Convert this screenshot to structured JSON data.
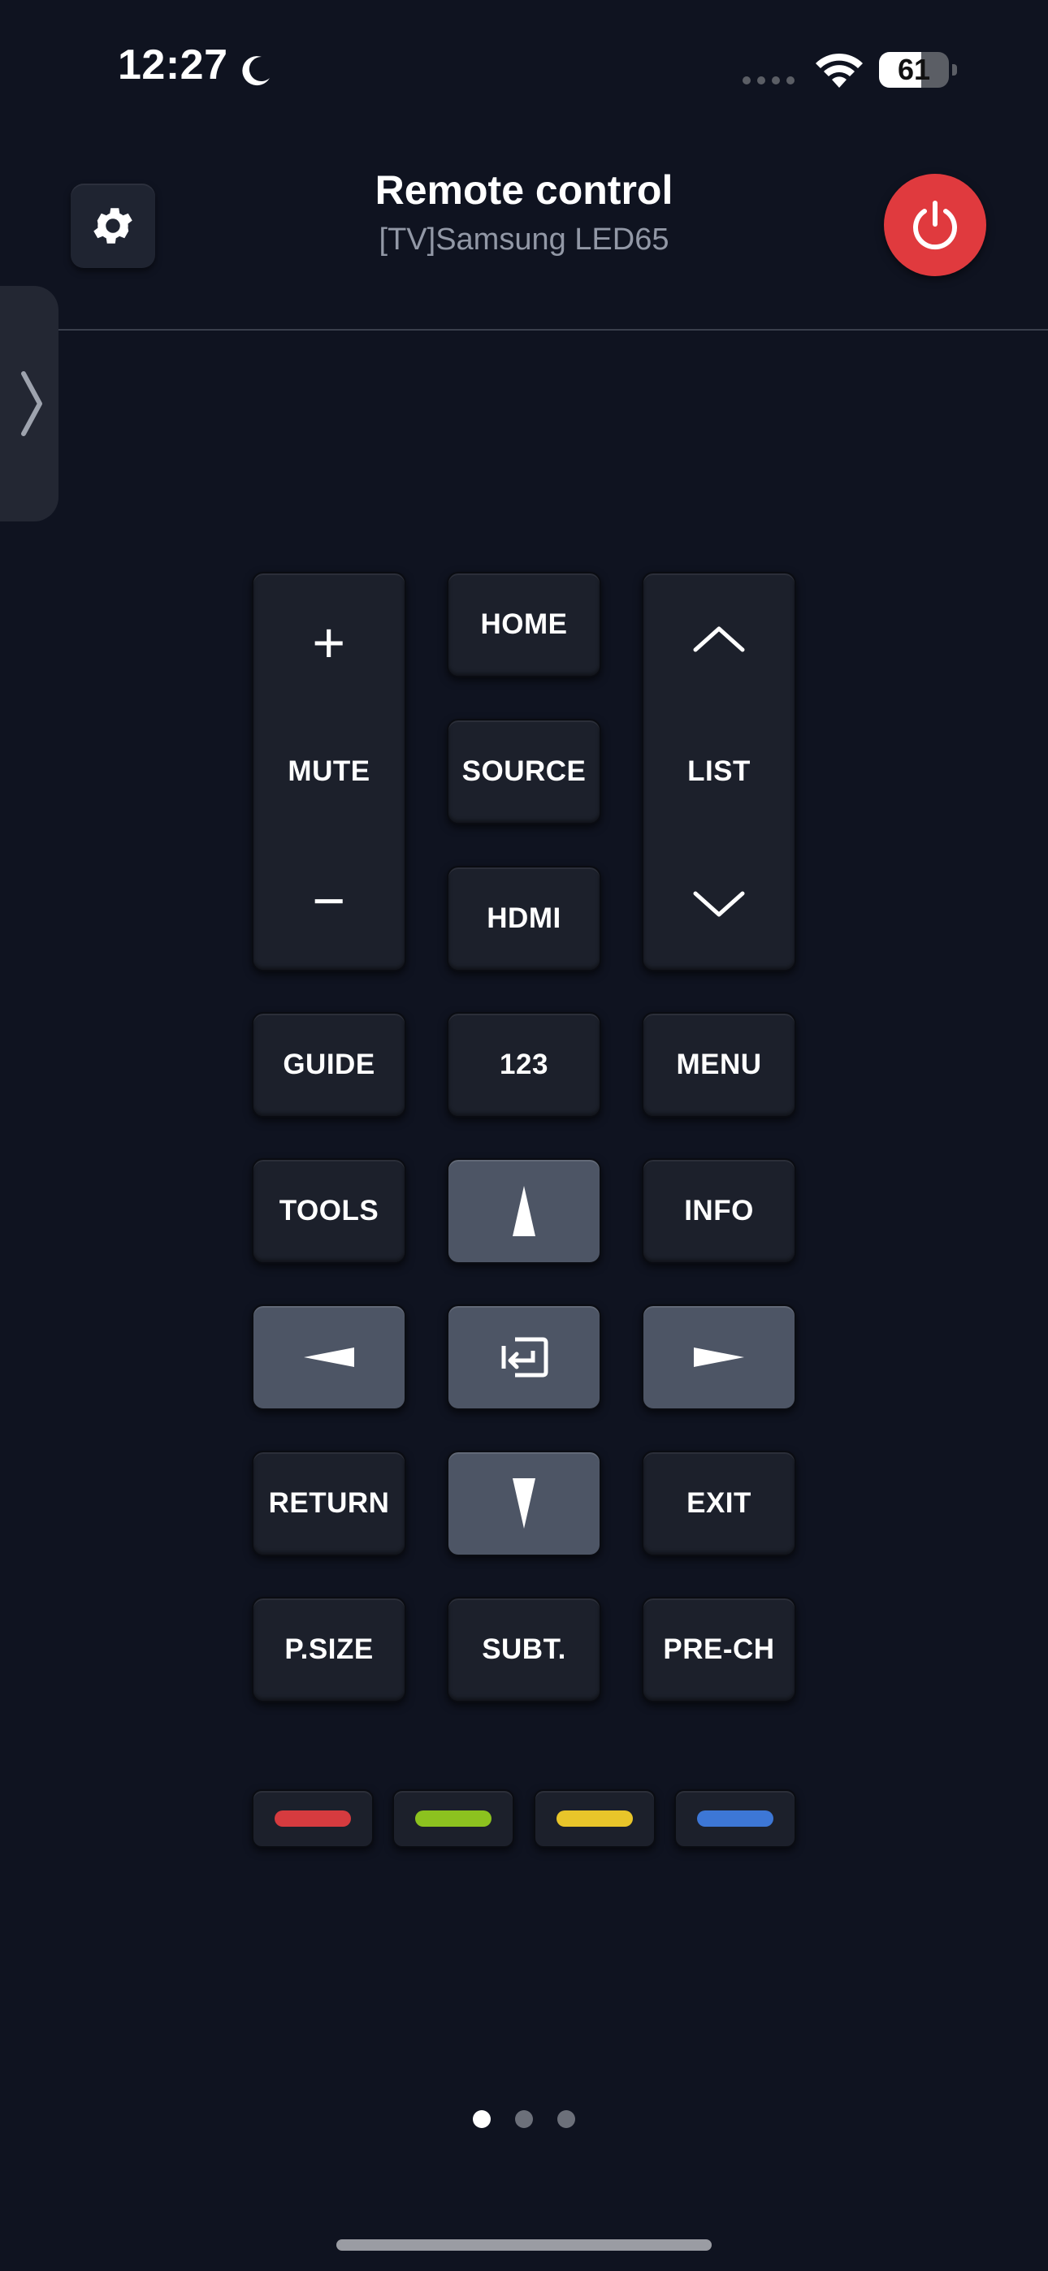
{
  "status_bar": {
    "time": "12:27",
    "battery": "61",
    "battery_level": 0.61
  },
  "header": {
    "title": "Remote control",
    "subtitle": "[TV]Samsung LED65"
  },
  "remote": {
    "volume": {
      "plus": "+",
      "label": "MUTE",
      "minus": "−"
    },
    "home": "HOME",
    "source": "SOURCE",
    "hdmi": "HDMI",
    "channel": {
      "label": "LIST"
    },
    "guide": "GUIDE",
    "num": "123",
    "menu": "MENU",
    "tools": "TOOLS",
    "info": "INFO",
    "return": "RETURN",
    "exit": "EXIT",
    "psize": "P.SIZE",
    "subt": "SUBT.",
    "prech": "PRE-CH"
  },
  "color_keys": [
    {
      "name": "red",
      "color": "#d63b3f"
    },
    {
      "name": "green",
      "color": "#8cc21f"
    },
    {
      "name": "yellow",
      "color": "#e8c52a"
    },
    {
      "name": "blue",
      "color": "#3d77d6"
    }
  ],
  "pager": {
    "count": 3,
    "active": 0
  },
  "colors": {
    "background": "#0f1320",
    "power": "#e03a3e",
    "dpad": "#4d5565"
  }
}
